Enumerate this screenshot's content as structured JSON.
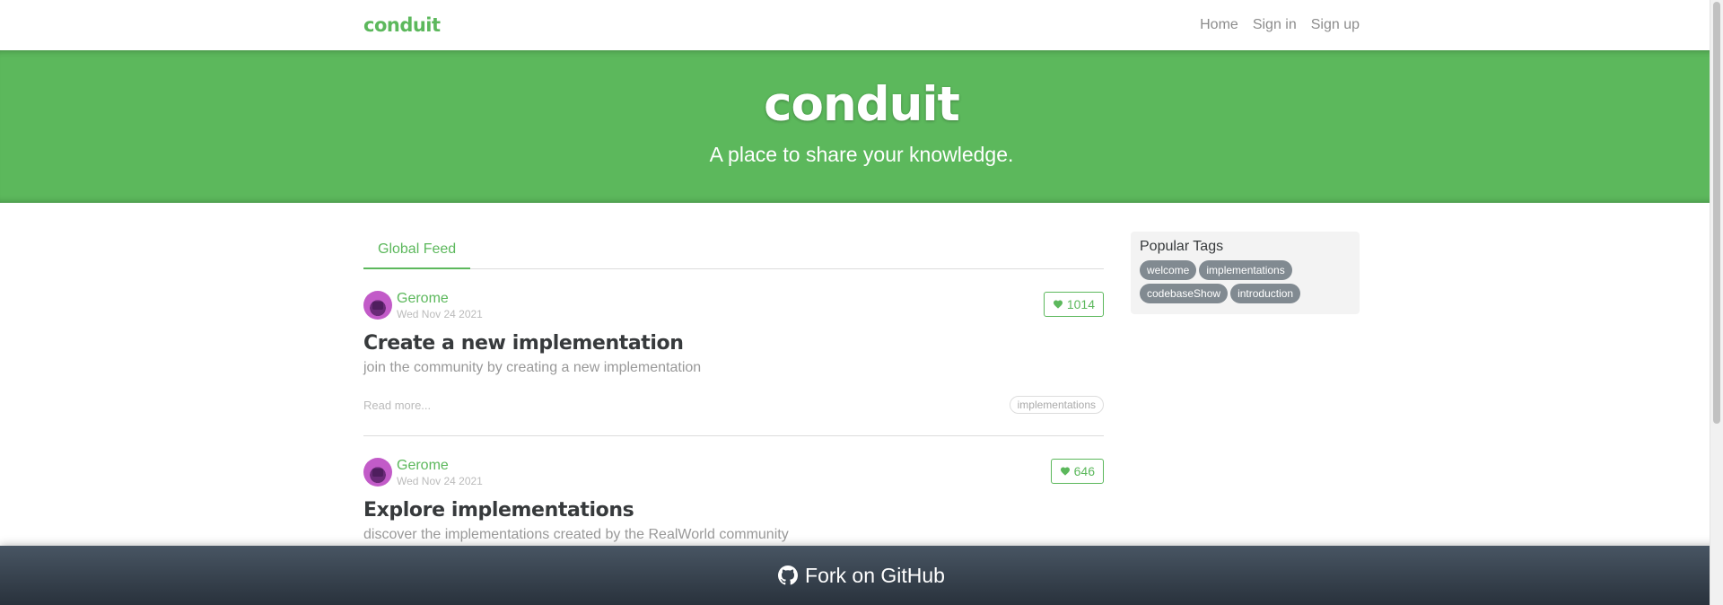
{
  "navbar": {
    "brand": "conduit",
    "links": [
      "Home",
      "Sign in",
      "Sign up"
    ]
  },
  "banner": {
    "title": "conduit",
    "subtitle": "A place to share your knowledge."
  },
  "feed": {
    "tab": "Global Feed",
    "articles": [
      {
        "author": "Gerome",
        "date": "Wed Nov 24 2021",
        "favorites": "1014",
        "title": "Create a new implementation",
        "description": "join the community by creating a new implementation",
        "read_more": "Read more...",
        "tags": [
          "implementations"
        ]
      },
      {
        "author": "Gerome",
        "date": "Wed Nov 24 2021",
        "favorites": "646",
        "title": "Explore implementations",
        "description": "discover the implementations created by the RealWorld community"
      }
    ]
  },
  "sidebar": {
    "title": "Popular Tags",
    "tags": [
      "welcome",
      "implementations",
      "codebaseShow",
      "introduction"
    ]
  },
  "footer": {
    "label": "Fork on GitHub"
  },
  "colors": {
    "brand": "#5cb85c",
    "footer": "#485563",
    "tag_pill": "#818a91"
  },
  "icons": {
    "favorite": "heart-icon",
    "github": "github-icon"
  }
}
